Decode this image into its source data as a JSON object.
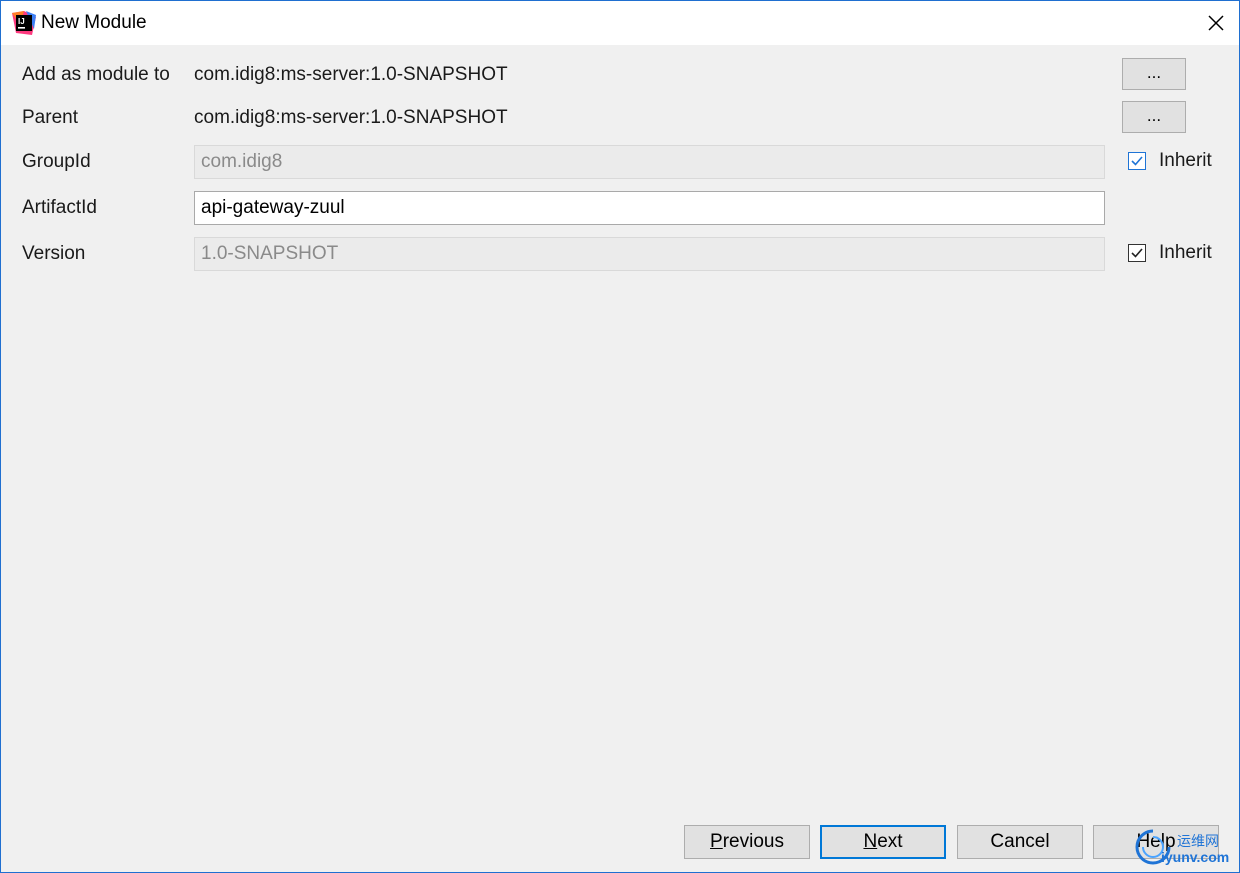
{
  "window": {
    "title": "New Module",
    "close_glyph": "✕"
  },
  "form": {
    "add_as_module": {
      "label": "Add as module to",
      "value": "com.idig8:ms-server:1.0-SNAPSHOT",
      "browse_label": "..."
    },
    "parent": {
      "label": "Parent",
      "value": "com.idig8:ms-server:1.0-SNAPSHOT",
      "browse_label": "..."
    },
    "group_id": {
      "label": "GroupId",
      "value": "com.idig8",
      "inherit_label": "Inherit",
      "inherit_checked": true
    },
    "artifact_id": {
      "label": "ArtifactId",
      "value": "api-gateway-zuul"
    },
    "version": {
      "label": "Version",
      "value": "1.0-SNAPSHOT",
      "inherit_label": "Inherit",
      "inherit_checked": true
    }
  },
  "buttons": {
    "previous": {
      "mnemonic": "P",
      "rest": "revious"
    },
    "next": {
      "mnemonic": "N",
      "rest": "ext"
    },
    "cancel": "Cancel",
    "help": "Help"
  },
  "watermark": {
    "top": "运维网",
    "bottom": "iyunv.com"
  },
  "colors": {
    "accent": "#0078d7",
    "window_bg": "#f0f0f0",
    "button_bg": "#e1e1e1"
  }
}
